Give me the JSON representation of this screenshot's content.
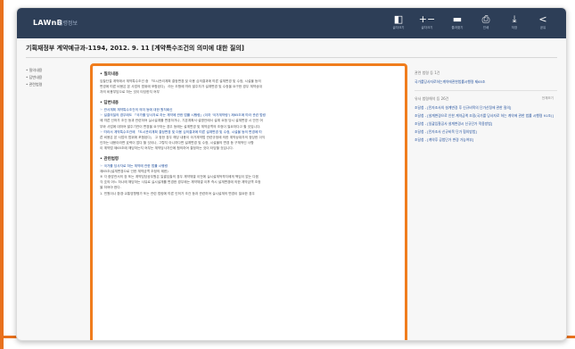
{
  "app": {
    "brand": "LAWnB",
    "brand_sub": "법령정보"
  },
  "toolbar": [
    {
      "glyph": "◧",
      "label": "글자크기"
    },
    {
      "glyph": "+−",
      "label": "글자크기"
    },
    {
      "glyph": "▬",
      "label": "즐겨찾기"
    },
    {
      "glyph": "⎙",
      "label": "인쇄"
    },
    {
      "glyph": "⤓",
      "label": "저장"
    },
    {
      "glyph": "<",
      "label": "공유"
    }
  ],
  "page_title": "기획재정부 계약예규과-1194, 2012. 9. 11 [계약특수조건의 의미에 대한 질의]",
  "left_nav": [
    "• 질의내용",
    "• 답변내용",
    "• 관련법령"
  ],
  "content": {
    "sections": [
      {
        "heading": "• 질의내용",
        "lines": [
          "입찰단절 계약에서 계약특수조건 중 「도시관리계획 결정변경 및 이용 심의결과에 따른 설계변경 및 수정, 시설물 등의",
          "변경에 따른 비용은 본 사업의 범위에 포함된다」 라는 조항에 따라 발주자가 설계변경 및 수정을 요구한 경우 계약상대",
          "자의 비용부담으로 하는 것이 타당한지 여부"
        ]
      },
      {
        "heading": "• 답변내용",
        "lines": [
          "☞ 관서계획 계약특수조건의 의미 등에 대한 원칙회신",
          "☞ 설결의질의 경우에도 「국가를 당사자로 하는 계약에 관한 법률 시행령」(이하 '국가계약령') 제65조에 따라 관련 법령",
          "에 따른 인허가 조건 등과 관련하여 실시설계를 변경하거나, 기본계획서·설명안에서 설계 요청 당시 설계변경 시 안전 여",
          "부와 사업에 대하여 발주기관이 변경을 요구하는 경우 등에는 설계변경 및 계약금액의 조정이 필요하다고 할 것입니다.",
          "☞ 따라서 계약특수조건에 「도시관리계획 결정변경 및 이용 심의결과에 따른 설계변경 및 수정, 시설물 등의 변경에 따",
          "른 비용은 본 사업의 범위에 포함된다」 고 정한 경우 해당 내용이 국가계약법 관련규정에 의한 계약상대자의 정당한 이익",
          "인하는 내용이라면 효력이 없다 할 것이나, 그렇지 아니하다면 설계변경 및 수정, 시설물의 변경 등 구체적인 사항",
          "이 계약법 제65조에 해당하는지 여부는 계약당사자간에 협의하여 결정하는 것이 타당할 것입니다."
        ]
      },
      {
        "heading": "• 관련법령",
        "lines": [
          "☞ 국가를 당사자로 하는 계약에 관한 법률 시행령",
          "제65조(설계변경으로 인한 계약금액 조정의 제한)",
          "⑥ 각 중앙관서의 장 또는 계약담당공무원은 일괄입찰의 경우 계약체결 이전에 실시설계적격자에게 책임이 없는 다음",
          "각 호의 어느 하나에 해당하는 사유로 실시설계를 변경한 경우에는 계약체결 이후 즉시 설계변경에 의한 계약금액 조정",
          "을 하여야 한다.",
          "1. 민원이나 환경·교통영향평가 또는 관련 법령에 따른 인허가 조건 등과 관련하여 실시설계의 변경이 필요한 경우"
        ]
      }
    ]
  },
  "right_pane": {
    "section1_head": "관련 법령 등 1건",
    "section1_items": [
      "국가를당사자로하는계약에관한법률시행령 제65조"
    ],
    "section2_head": "유사 법령해석 등 26건",
    "section2_more": "전체보기",
    "section2_items": [
      "조달청 - [민자조사의 설계변경 후 신규비목의 단가산정에 관한 질의]",
      "조달청 - [설계변경으로 인한 계약금액 조정(국가를 당사자로 하는 계약에 관한 법률 시행령 91조)]",
      "조달청 - [일괄입찰공사 설계변경시 신규단가 적용방법]",
      "조달청 - [민자조사 신규비목 단가 협의방법]",
      "조달청 - [계약후 공법단가 변경 가능여부]"
    ]
  },
  "colors": {
    "accent": "#f07d1d",
    "topbar": "#2d3e57",
    "link": "#1f4e9c"
  }
}
